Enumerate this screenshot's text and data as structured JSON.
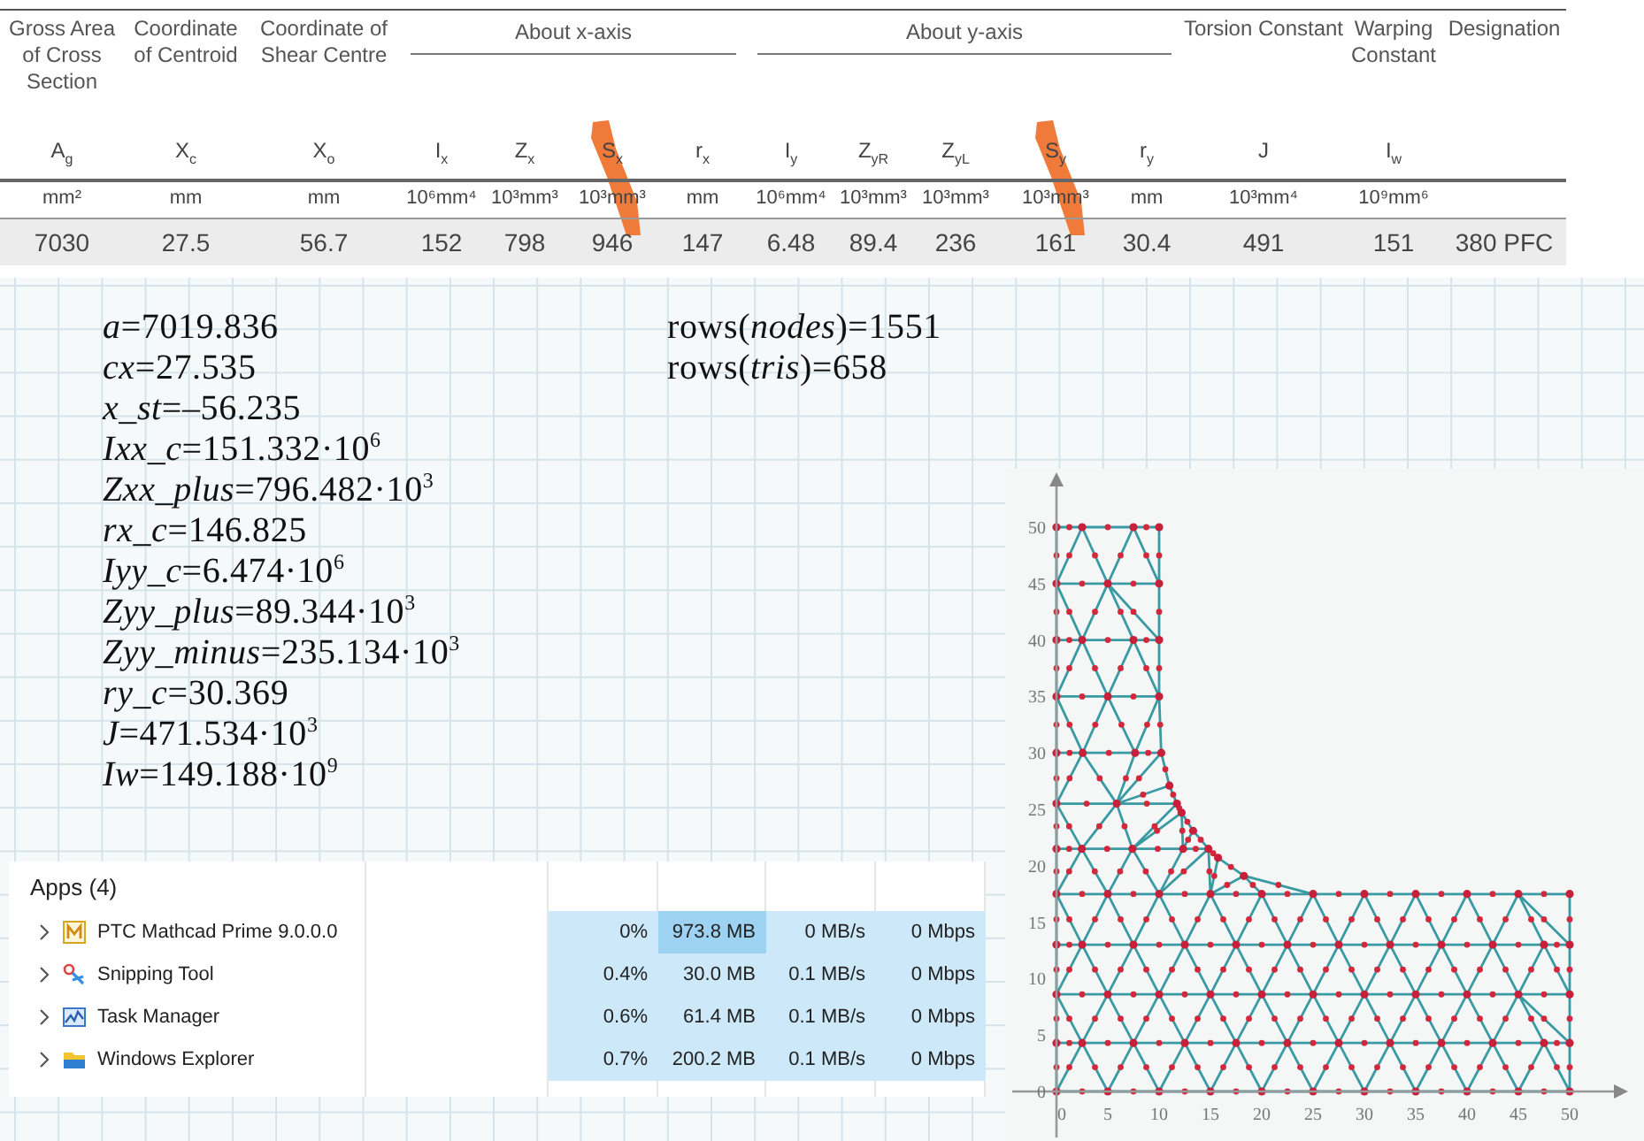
{
  "spec_table": {
    "columns": [
      {
        "heading": "Gross Area of Cross Section",
        "symbol": "A$_{g}$",
        "unit": "mm²",
        "highlighted": false
      },
      {
        "heading": "Coordinate of Centroid",
        "symbol": "X$_{c}$",
        "unit": "mm",
        "highlighted": false
      },
      {
        "heading": "Coordinate of Shear Centre",
        "symbol": "X$_{o}$",
        "unit": "mm",
        "highlighted": false
      },
      {
        "group": "About x-axis",
        "symbol": "I$_{x}$",
        "unit": "10⁶mm⁴",
        "highlighted": false
      },
      {
        "grouped": true,
        "symbol": "Z$_{x}$",
        "unit": "10³mm³",
        "highlighted": false
      },
      {
        "grouped": true,
        "symbol": "S$_{x}$",
        "unit": "10³mm³",
        "highlighted": true
      },
      {
        "grouped": true,
        "symbol": "r$_{x}$",
        "unit": "mm",
        "highlighted": false
      },
      {
        "group": "About y-axis",
        "symbol": "I$_{y}$",
        "unit": "10⁶mm⁴",
        "highlighted": false
      },
      {
        "grouped": true,
        "symbol": "Z$_{yR}$",
        "unit": "10³mm³",
        "highlighted": false
      },
      {
        "grouped": true,
        "symbol": "Z$_{yL}$",
        "unit": "10³mm³",
        "highlighted": false
      },
      {
        "grouped": true,
        "symbol": "S$_{y}$",
        "unit": "10³mm³",
        "highlighted": true
      },
      {
        "grouped": true,
        "symbol": "r$_{y}$",
        "unit": "mm",
        "highlighted": false
      },
      {
        "heading": "Torsion Constant",
        "symbol": "J",
        "unit": "10³mm⁴",
        "highlighted": false
      },
      {
        "heading": "Warping Constant",
        "symbol": "I$_{w}$",
        "unit": "10⁹mm⁶",
        "highlighted": false
      },
      {
        "heading": "Designation",
        "highlighted": false
      }
    ],
    "rows": [
      [
        "7030",
        "27.5",
        "56.7",
        "152",
        "798",
        "946",
        "147",
        "6.48",
        "89.4",
        "236",
        "161",
        "30.4",
        "491",
        "151",
        "380 PFC"
      ]
    ]
  },
  "worksheet": {
    "results": [
      "*a*=7019.836",
      "*cx*=27.535",
      "*x_st*=–56.235",
      "*Ixx_c*=151.332·10$^{6}$",
      "*Zxx_plus*=796.482·10$^{3}$",
      "*rx_c*=146.825",
      "*Iyy_c*=6.474·10$^{6}$",
      "*Zyy_plus*=89.344·10$^{3}$",
      "*Zyy_minus*=235.134·10$^{3}$",
      "*ry_c*=30.369",
      "*J*=471.534·10$^{3}$",
      "*Iw*=149.188·10$^{9}$"
    ],
    "counts": [
      "rows(*nodes*)=1551",
      "rows(*tris*)=658"
    ]
  },
  "task_manager": {
    "section": "Apps (4)",
    "rows": [
      {
        "kind": "mathcad",
        "name": "PTC Mathcad Prime 9.0.0.0",
        "expanded": false,
        "cpu": "0%",
        "memory": "973.8 MB",
        "memory_highlighted": true,
        "disk": "0 MB/s",
        "network": "0 Mbps"
      },
      {
        "kind": "snipping",
        "name": "Snipping Tool",
        "expanded": false,
        "cpu": "0.4%",
        "memory": "30.0 MB",
        "memory_highlighted": false,
        "disk": "0.1 MB/s",
        "network": "0 Mbps"
      },
      {
        "kind": "taskmgr",
        "name": "Task Manager",
        "expanded": false,
        "cpu": "0.6%",
        "memory": "61.4 MB",
        "memory_highlighted": false,
        "disk": "0.1 MB/s",
        "network": "0 Mbps"
      },
      {
        "kind": "explorer",
        "name": "Windows Explorer",
        "expanded": false,
        "cpu": "0.7%",
        "memory": "200.2 MB",
        "memory_highlighted": false,
        "disk": "0.1 MB/s",
        "network": "0 Mbps"
      }
    ]
  },
  "mesh_plot": {
    "yticks": [
      "50",
      "45",
      "40",
      "35",
      "30",
      "25",
      "20",
      "15",
      "10",
      "5",
      "0"
    ],
    "xticks": [
      "0",
      "5",
      "10",
      "15",
      "20",
      "25",
      "30",
      "35",
      "40",
      "45",
      "50"
    ]
  }
}
